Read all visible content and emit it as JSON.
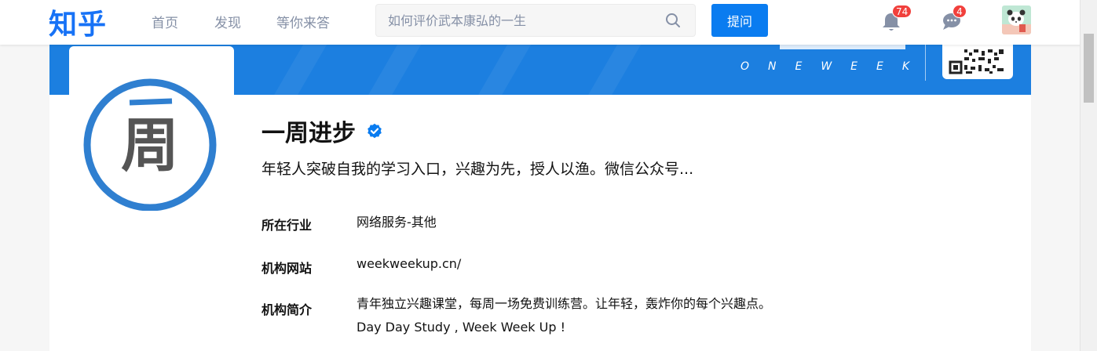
{
  "header": {
    "logo": "知乎",
    "nav": [
      "首页",
      "发现",
      "等你来答"
    ],
    "search_placeholder": "如何评价武本康弘的一生",
    "ask_label": "提问",
    "notifications": {
      "icon": "bell-icon",
      "count": "74"
    },
    "messages": {
      "icon": "chat-bubble-icon",
      "count": "4"
    },
    "avatar_icon": "user-avatar"
  },
  "cover": {
    "english_tagline": "ONEWEEK"
  },
  "profile": {
    "logo_glyph": "周",
    "name": "一周进步",
    "verified_icon": "verified-badge-icon",
    "headline": "年轻人突破自我的学习入口，兴趣为先，授人以渔。微信公众号...",
    "info": [
      {
        "label": "所在行业",
        "value": "网络服务-其他"
      },
      {
        "label": "机构网站",
        "value": "weekweekup.cn/"
      },
      {
        "label": "机构简介",
        "value": "青年独立兴趣课堂，每周一场免费训练营。让年轻，轰炸你的每个兴趣点。Day Day Study , Week Week Up !"
      }
    ]
  },
  "colors": {
    "brand": "#1772f6",
    "cover": "#1c7fe0",
    "badge": "#f1403c"
  }
}
